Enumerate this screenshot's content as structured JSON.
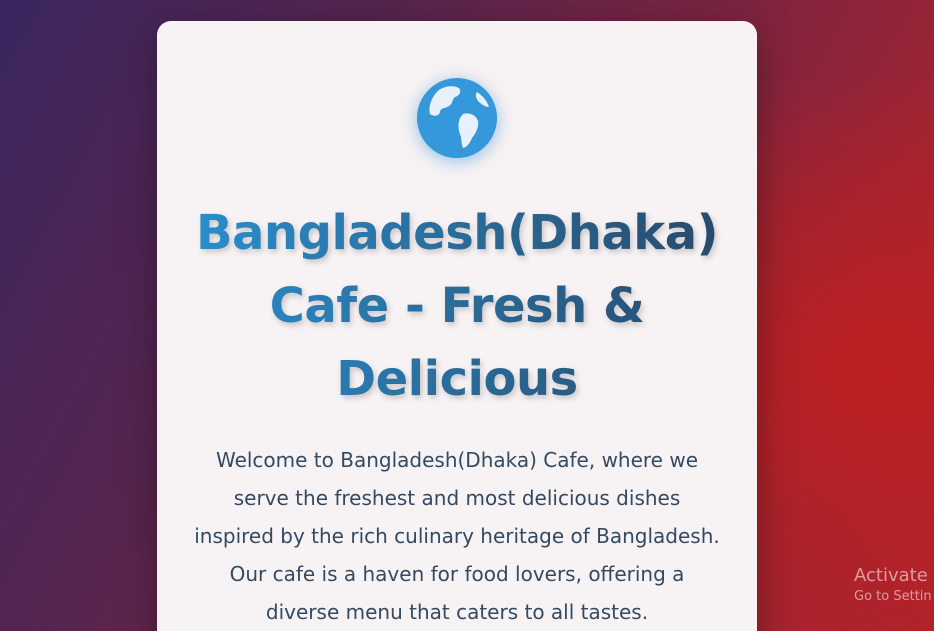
{
  "hero": {
    "icon": "globe-icon",
    "title": "Bangladesh(Dhaka) Cafe - Fresh & Delicious",
    "intro": "Welcome to Bangladesh(Dhaka) Cafe, where we serve the freshest and most delicious dishes inspired by the rich culinary heritage of Bangladesh. Our cafe is a haven for food lovers, offering a diverse menu that caters to all tastes."
  },
  "watermark": {
    "title": "Activate W",
    "subtitle": "Go to Settin"
  },
  "colors": {
    "icon": "#3498db",
    "title_start": "#2b8fd0",
    "title_end": "#27486a",
    "body_text": "#344a63",
    "card_bg": "#f7f2f3"
  }
}
